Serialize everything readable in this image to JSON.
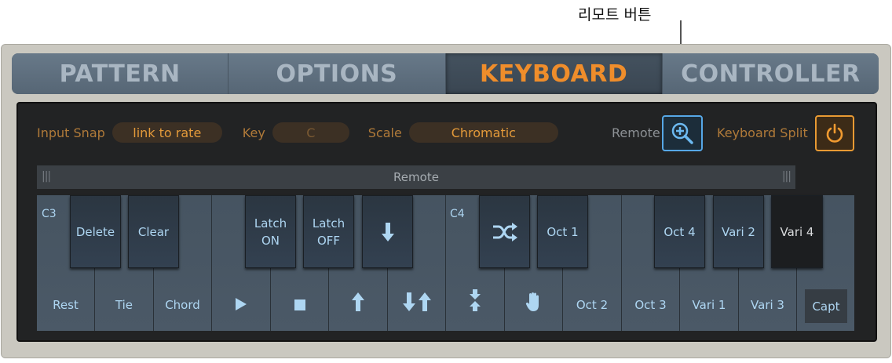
{
  "callout": {
    "label": "리모트 버튼"
  },
  "tabs": [
    {
      "label": "PATTERN",
      "active": false
    },
    {
      "label": "OPTIONS",
      "active": false
    },
    {
      "label": "KEYBOARD",
      "active": true
    },
    {
      "label": "CONTROLLER",
      "active": false
    }
  ],
  "controls": {
    "input_snap_label": "Input Snap",
    "input_snap_value": "link to rate",
    "key_label": "Key",
    "key_value": "C",
    "scale_label": "Scale",
    "scale_value": "Chromatic",
    "remote_label": "Remote",
    "keyboard_split_label": "Keyboard Split"
  },
  "remote_strip": {
    "label": "Remote"
  },
  "keyboard": {
    "note_c3": "C3",
    "note_c4": "C4",
    "white_keys": [
      "Rest",
      "Tie",
      "Chord",
      "",
      "",
      "",
      "",
      "",
      "",
      "Oct 2",
      "Oct 3",
      "Vari 1",
      "Vari 3"
    ],
    "black_keys": [
      "Delete",
      "Clear",
      "Latch\nON",
      "Latch\nOFF",
      "",
      "",
      "Oct 1",
      "Oct 4",
      "Vari 2",
      "Vari 4"
    ],
    "capture_label": "Capt"
  },
  "colors": {
    "accent_orange": "#ef8d2b",
    "remote_blue": "#56a7e6",
    "key_text": "#aed6f2"
  }
}
